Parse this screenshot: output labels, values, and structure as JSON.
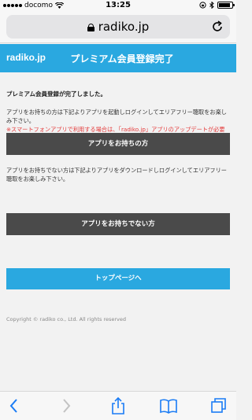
{
  "status_bar": {
    "carrier": "docomo",
    "time": "13:25",
    "battery_level": 0.85
  },
  "browser": {
    "url": "radiko.jp"
  },
  "header": {
    "logo": "radiko.jp",
    "title": "プレミアム会員登録完了"
  },
  "main": {
    "message_title": "プレミアム会員登録が完了しました。",
    "app_owner_text": "アプリをお持ちの方は下記よりアプリを起動しログインしてエリアフリー聴取をお楽しみ下さい。",
    "app_owner_warning": "※スマートフォンアプリで利用する場合は、「radiko.jp」アプリのアップデートが必要です。",
    "app_owner_button": "アプリをお持ちの方",
    "no_app_text": "アプリをお持ちでない方は下記よりアプリをダウンロードしログインしてエリアフリー聴取をお楽しみ下さい。",
    "no_app_button": "アプリをお持ちでない方",
    "top_page_button": "トップページへ",
    "copyright": "Copyright © radiko co., Ltd. All rights reserved"
  },
  "colors": {
    "brand": "#2aa8e0",
    "button_dark": "#4a4a4a",
    "warning": "#e43a3a",
    "toolbar_icon": "#1a7cf5"
  }
}
